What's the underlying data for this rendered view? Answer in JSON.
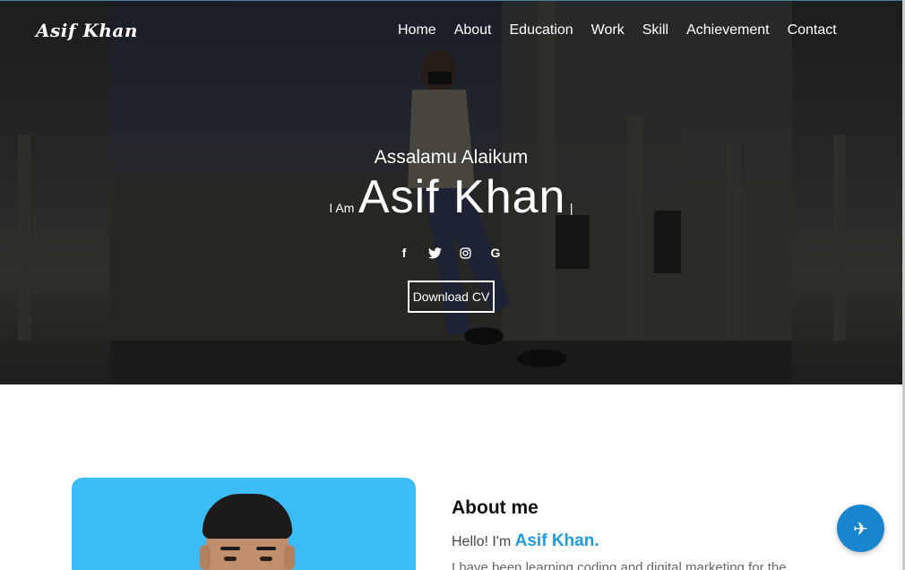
{
  "brand": {
    "logo_text": "Asif Khan"
  },
  "nav": {
    "items": [
      {
        "label": "Home"
      },
      {
        "label": "About"
      },
      {
        "label": "Education"
      },
      {
        "label": "Work"
      },
      {
        "label": "Skill"
      },
      {
        "label": "Achievement"
      },
      {
        "label": "Contact"
      }
    ]
  },
  "hero": {
    "greeting": "Assalamu Alaikum",
    "prefix": "I Am",
    "name": "Asif Khan",
    "cursor": "|",
    "social_icons": [
      "facebook-icon",
      "twitter-icon",
      "instagram-icon",
      "google-icon"
    ],
    "social_glyphs": [
      "f",
      "🐦",
      "◎",
      "G"
    ],
    "cv_button": "Download CV"
  },
  "about": {
    "title": "About me",
    "hello_prefix": "Hello! I'm",
    "hello_name": "Asif Khan.",
    "description": "I have been learning coding and digital marketing for the"
  },
  "fab": {
    "icon": "plane-icon",
    "glyph": "✈"
  },
  "colors": {
    "accent": "#1e9be0",
    "card_bg": "#3cbcf5",
    "fab_bg": "#1a85cf"
  }
}
